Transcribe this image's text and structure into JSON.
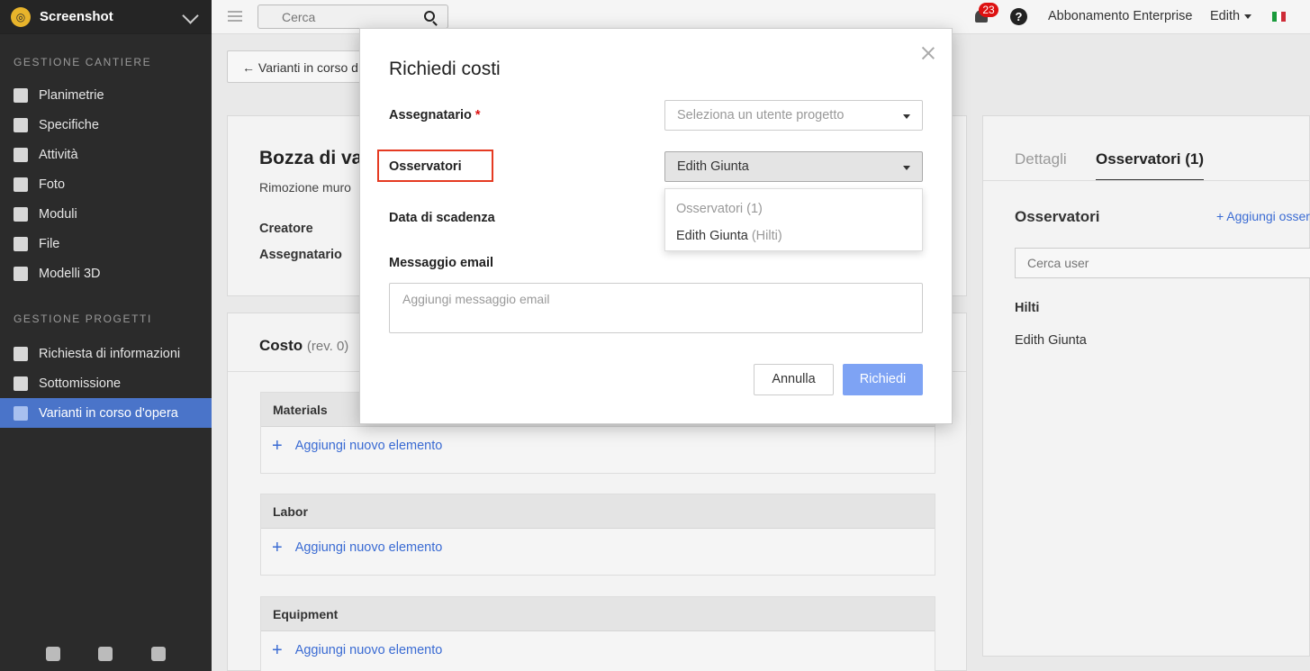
{
  "sidebar": {
    "brand": "Screenshot",
    "section_site": "GESTIONE CANTIERE",
    "site_items": [
      "Planimetrie",
      "Specifiche",
      "Attività",
      "Foto",
      "Moduli",
      "File",
      "Modelli 3D"
    ],
    "section_projects": "GESTIONE PROGETTI",
    "project_items": [
      "Richiesta di informazioni",
      "Sottomissione",
      "Varianti in corso d'opera"
    ],
    "active_item": "Varianti in corso d'opera"
  },
  "topbar": {
    "search_placeholder": "Cerca",
    "notification_count": "23",
    "help": "?",
    "plan": "Abbonamento Enterprise",
    "user": "Edith",
    "flag_colors": [
      "#1a9b3c",
      "#ffffff",
      "#ce2b37"
    ]
  },
  "content": {
    "back_label": "Varianti in corso d",
    "card1": {
      "title": "Bozza di va",
      "subtitle": "Rimozione muro",
      "creator_label": "Creatore",
      "assignee_label": "Assegnatario"
    },
    "card2": {
      "title": "Costo",
      "revision": "(rev. 0)",
      "groups": [
        {
          "name": "Materials",
          "add": "Aggiungi nuovo elemento"
        },
        {
          "name": "Labor",
          "add": "Aggiungi nuovo elemento"
        },
        {
          "name": "Equipment",
          "add": "Aggiungi nuovo elemento"
        }
      ]
    },
    "right_panel": {
      "tab_details": "Dettagli",
      "tab_observers": "Osservatori (1)",
      "observers_title": "Osservatori",
      "add_observer": "+ Aggiungi osserv",
      "search_placeholder": "Cerca user",
      "company": "Hilti",
      "member": "Edith Giunta"
    }
  },
  "modal": {
    "title": "Richiedi costi",
    "assignee_label": "Assegnatario",
    "required_mark": "*",
    "assignee_placeholder": "Seleziona un utente progetto",
    "observers_label": "Osservatori",
    "observers_value": "Edith Giunta",
    "dropdown_header": "Osservatori (1)",
    "dropdown_option_name": "Edith Giunta",
    "dropdown_option_company": "(Hilti)",
    "due_date_label": "Data di scadenza",
    "email_label": "Messaggio email",
    "email_placeholder": "Aggiungi messaggio email",
    "cancel": "Annulla",
    "submit": "Richiedi"
  },
  "colors": {
    "accent": "#4a74c9",
    "link": "#3a6bd3",
    "highlight": "#e53a22",
    "submit": "#7ea3f4"
  }
}
